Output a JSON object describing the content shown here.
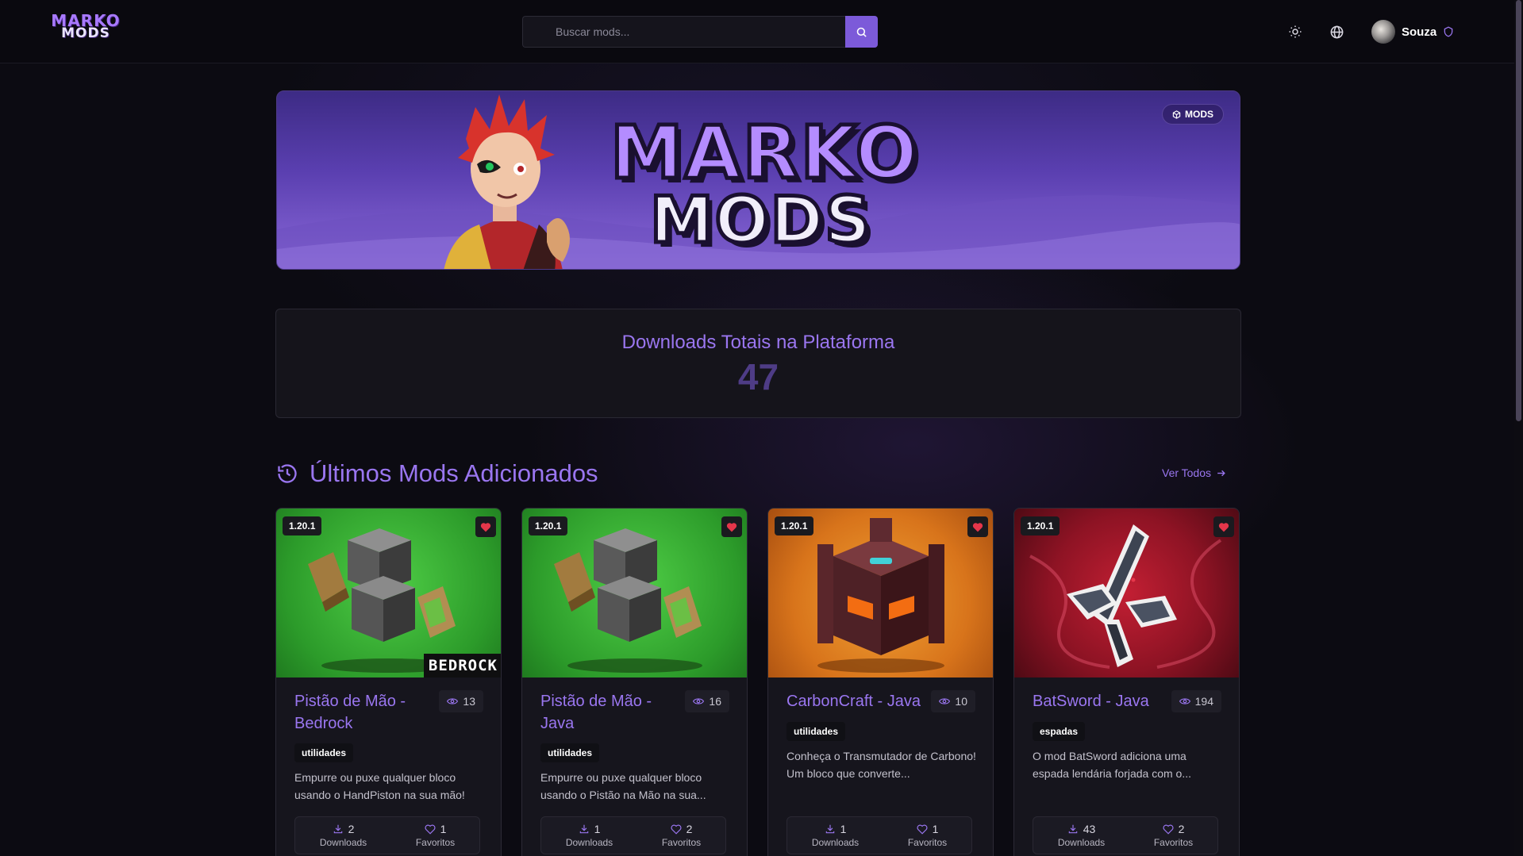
{
  "header": {
    "logo_line1": "MARKO",
    "logo_line2": "MODS",
    "search_placeholder": "Buscar mods...",
    "user_name": "Souza"
  },
  "banner": {
    "logo_line1": "MARKO",
    "logo_line2": "MODS",
    "badge": "MODS"
  },
  "stats": {
    "title": "Downloads Totais na Plataforma",
    "value": "47"
  },
  "section": {
    "title": "Últimos Mods Adicionados",
    "see_all": "Ver Todos"
  },
  "colors": {
    "accent": "#9a76f0",
    "button": "#7c5ad9",
    "heart": "#e5364a"
  },
  "cards": [
    {
      "version": "1.20.1",
      "title": "Pistão de Mão - Bedrock",
      "views": "13",
      "tag": "utilidades",
      "description": "Empurre ou puxe qualquer bloco usando o HandPiston na sua mão!",
      "downloads": "2",
      "downloads_label": "Downloads",
      "favorites": "1",
      "favorites_label": "Favoritos",
      "image_label": "BEDROCK"
    },
    {
      "version": "1.20.1",
      "title": "Pistão de Mão - Java",
      "views": "16",
      "tag": "utilidades",
      "description": "Empurre ou puxe qualquer bloco usando o Pistão na Mão na sua...",
      "downloads": "1",
      "downloads_label": "Downloads",
      "favorites": "2",
      "favorites_label": "Favoritos"
    },
    {
      "version": "1.20.1",
      "title": "CarbonCraft - Java",
      "views": "10",
      "tag": "utilidades",
      "description": "Conheça o Transmutador de Carbono! Um bloco que converte...",
      "downloads": "1",
      "downloads_label": "Downloads",
      "favorites": "1",
      "favorites_label": "Favoritos"
    },
    {
      "version": "1.20.1",
      "title": "BatSword - Java",
      "views": "194",
      "tag": "espadas",
      "description": "O mod BatSword adiciona uma espada lendária forjada com o...",
      "downloads": "43",
      "downloads_label": "Downloads",
      "favorites": "2",
      "favorites_label": "Favoritos"
    }
  ]
}
